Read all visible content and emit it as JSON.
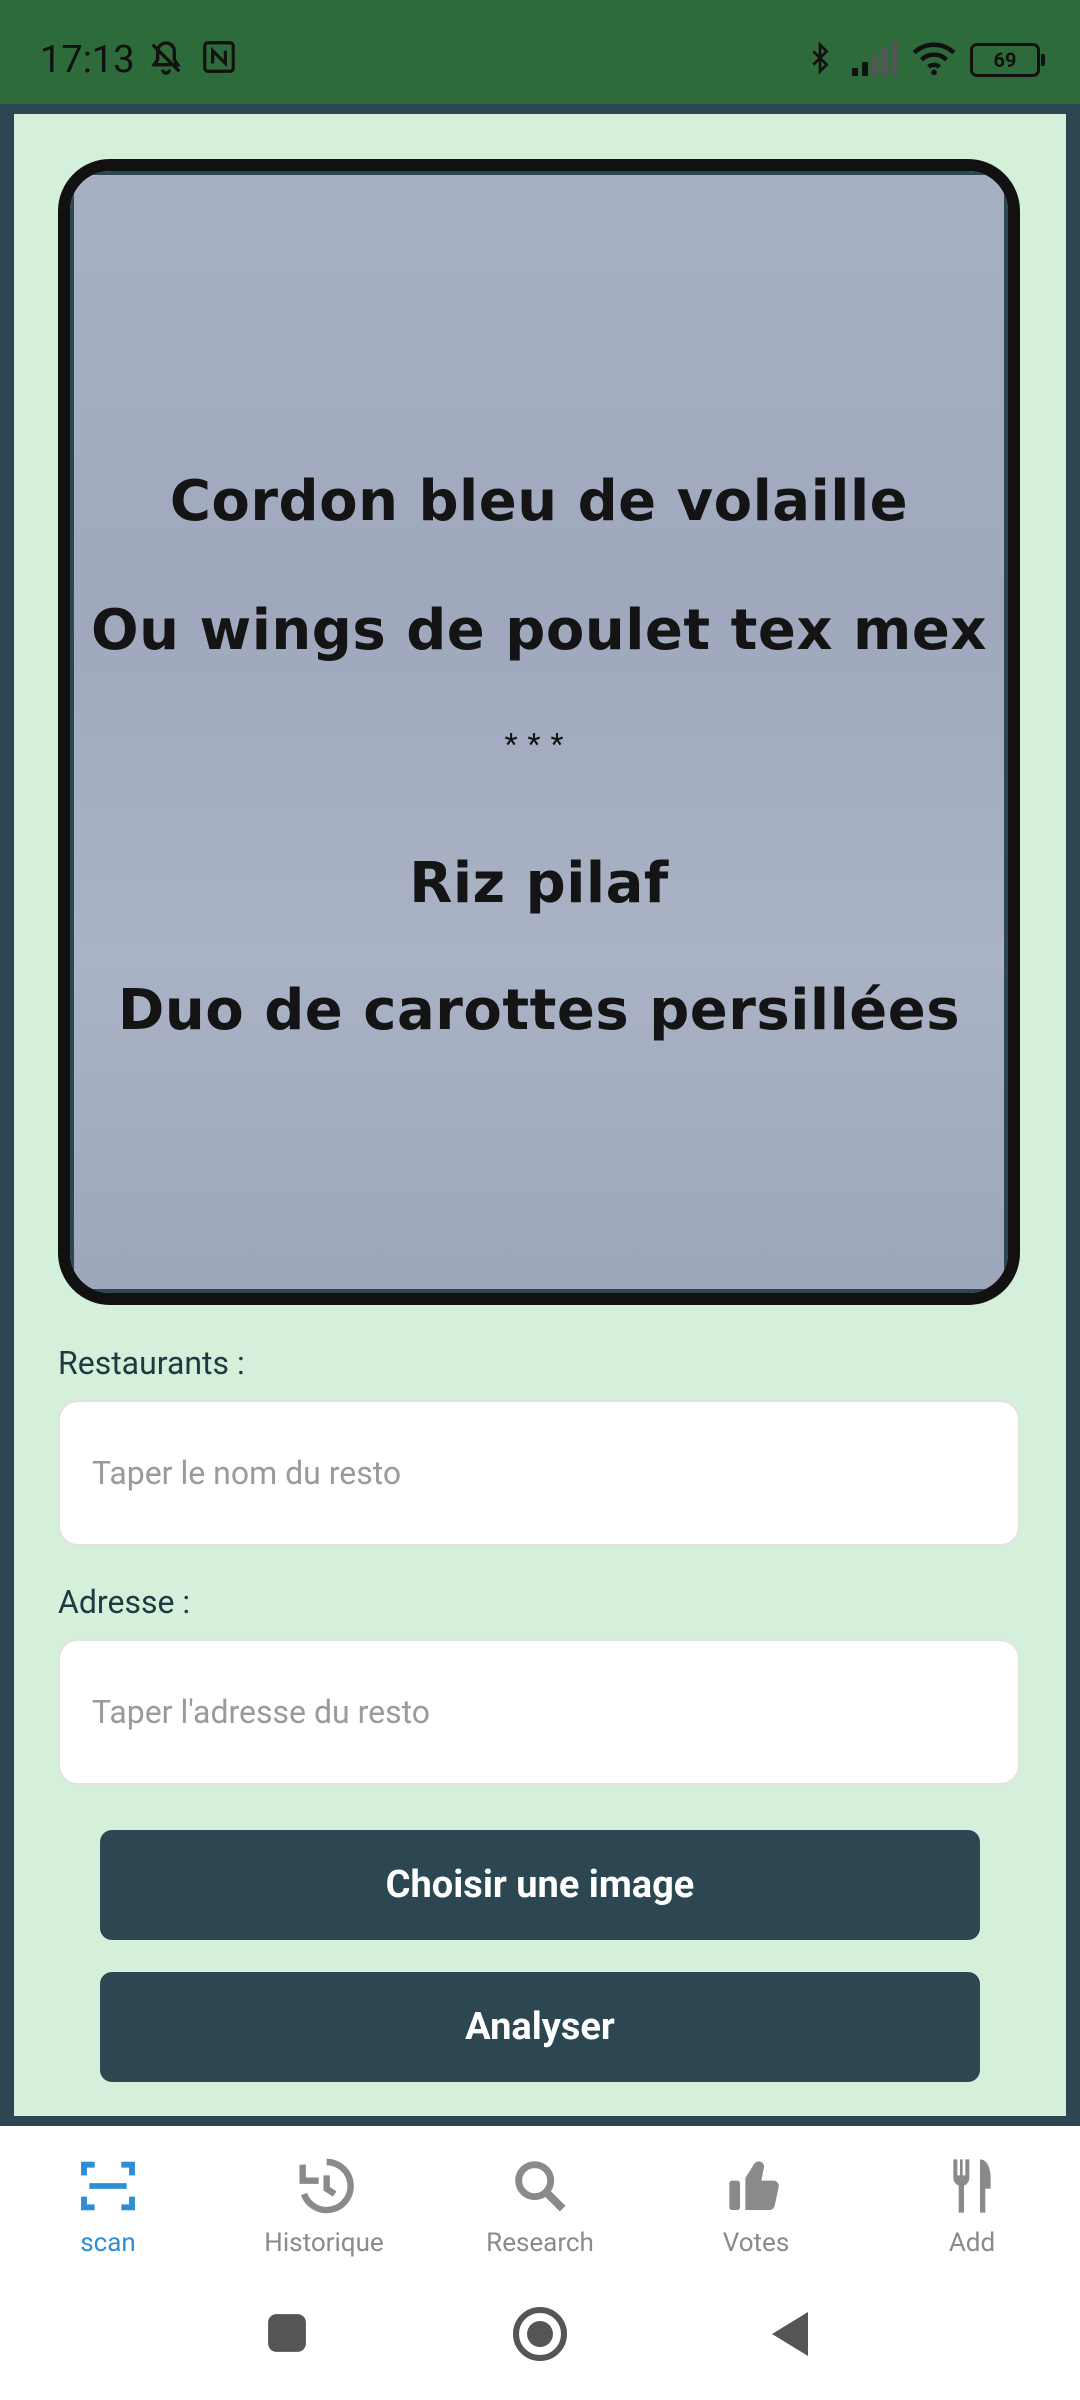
{
  "status_bar": {
    "time": "17:13",
    "battery": "69",
    "icons": [
      "mute-icon",
      "nfc-icon",
      "bluetooth-icon",
      "signal-icon",
      "wifi-icon",
      "battery-icon"
    ]
  },
  "menu_image": {
    "lines": [
      "Cordon bleu de volaille",
      "Ou wings de poulet tex mex",
      "***",
      "Riz pilaf",
      "Duo de carottes persillées"
    ]
  },
  "form": {
    "restaurant_label": "Restaurants :",
    "restaurant_placeholder": "Taper le nom du resto",
    "address_label": "Adresse :",
    "address_placeholder": "Taper l'adresse du resto",
    "choose_image_button": "Choisir une image",
    "analyze_button": "Analyser"
  },
  "bottom_nav": {
    "items": [
      {
        "label": "scan",
        "icon": "scan-icon",
        "active": true
      },
      {
        "label": "Historique",
        "icon": "history-icon",
        "active": false
      },
      {
        "label": "Research",
        "icon": "search-icon",
        "active": false
      },
      {
        "label": "Votes",
        "icon": "thumbs-up-icon",
        "active": false
      },
      {
        "label": "Add",
        "icon": "fork-knife-icon",
        "active": false
      }
    ]
  },
  "colors": {
    "status_bar": "#2e6b3b",
    "frame": "#2c4752",
    "content_bg": "#d4f0da",
    "button_bg": "#2c4752",
    "active_nav": "#2c8fd6",
    "inactive_nav": "#8a8a8a"
  }
}
